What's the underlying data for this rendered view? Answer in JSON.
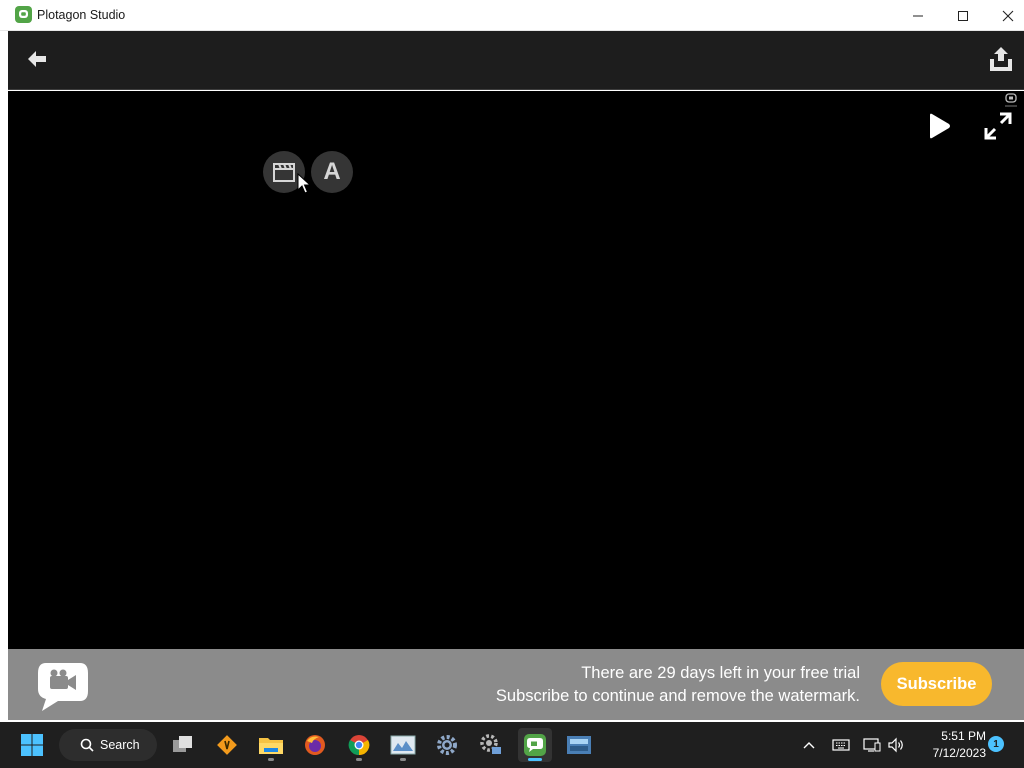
{
  "window": {
    "title": "Plotagon Studio"
  },
  "banner": {
    "line1": "There are 29 days left in your free trial",
    "line2": "Subscribe to continue and remove the watermark.",
    "subscribe_label": "Subscribe"
  },
  "stage": {
    "text_button_label": "A"
  },
  "taskbar": {
    "search_label": "Search",
    "time": "5:51 PM",
    "date": "7/12/2023",
    "notification_count": "1"
  },
  "colors": {
    "brand_green": "#52a447",
    "subscribe_yellow": "#f8b82d",
    "banner_gray": "#8b8b8b",
    "taskbar_accent": "#4cc2ff"
  },
  "icons": [
    "plotagon-app-icon",
    "minimize-icon",
    "maximize-icon",
    "close-icon",
    "back-arrow-icon",
    "share-upload-icon",
    "play-icon",
    "fullscreen-icon",
    "clapperboard-icon",
    "plotagon-logo-icon",
    "windows-start-icon",
    "search-icon",
    "task-view-icon",
    "vlc-icon",
    "file-explorer-icon",
    "firefox-icon",
    "chrome-icon",
    "photos-icon",
    "settings-icon",
    "settings-tool-icon",
    "plotagon-taskbar-icon",
    "keyboard-app-icon",
    "chevron-up-icon",
    "keyboard-icon",
    "network-icon",
    "volume-icon"
  ]
}
